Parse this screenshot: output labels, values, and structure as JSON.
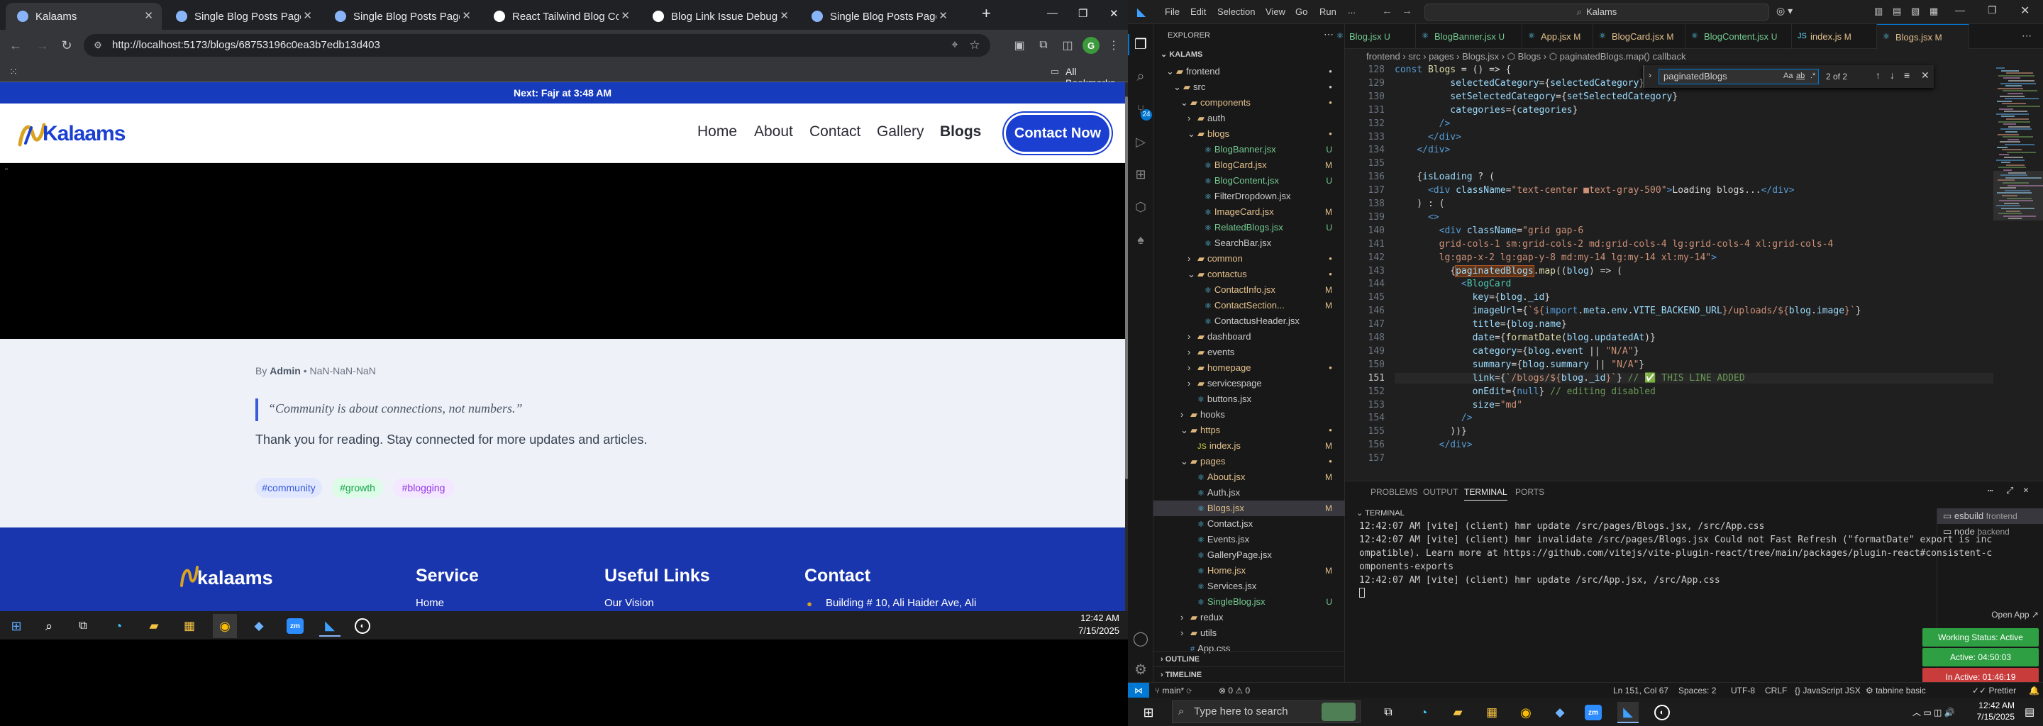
{
  "chrome": {
    "tabs": [
      {
        "title": "Kalaams"
      },
      {
        "title": "Single Blog Posts Page Design"
      },
      {
        "title": "Single Blog Posts Page Design"
      },
      {
        "title": "React Tailwind Blog Conversion"
      },
      {
        "title": "Blog Link Issue Debugging"
      },
      {
        "title": "Single Blog Posts Page Design"
      }
    ],
    "new_tab": "+",
    "url": "http://localhost:5173/blogs/68753196c0ea3b7edb13d403",
    "all_bookmarks": "All Bookmarks",
    "profile_initial": "G"
  },
  "site": {
    "announcement": "Next: Fajr at 3:48 AM",
    "logo": "Kalaams",
    "nav": [
      "Home",
      "About",
      "Contact",
      "Gallery",
      "Blogs"
    ],
    "cta": "Contact Now",
    "meta_by": "By",
    "meta_author": "Admin",
    "meta_date": "• NaN-NaN-NaN",
    "quote": "“Community is about connections, not numbers.”",
    "thanks": "Thank you for reading. Stay connected for more updates and articles.",
    "tags": [
      "#community",
      "#growth",
      "#blogging"
    ],
    "footer": {
      "logo": "kalaams",
      "cols": [
        {
          "title": "Service",
          "item": "Home"
        },
        {
          "title": "Useful Links",
          "item": "Our Vision"
        },
        {
          "title": "Contact",
          "item": "Building # 10, Ali Haider Ave, Ali"
        }
      ]
    }
  },
  "taskbar_left": {
    "time": "12:42 AM",
    "date": "7/15/2025"
  },
  "vscode": {
    "menu": [
      "File",
      "Edit",
      "Selection",
      "View",
      "Go",
      "Run",
      "..."
    ],
    "search": "Kalams",
    "tabs": [
      {
        "name": "Blog.jsx",
        "flag": "U"
      },
      {
        "name": "BlogBanner.jsx",
        "flag": "U"
      },
      {
        "name": "App.jsx",
        "flag": "M"
      },
      {
        "name": "BlogCard.jsx",
        "flag": "M"
      },
      {
        "name": "BlogContent.jsx",
        "flag": "U"
      },
      {
        "name": "index.js",
        "flag": "M"
      },
      {
        "name": "Blogs.jsx",
        "flag": "M"
      }
    ],
    "breadcrumb": "frontend › src › pages › Blogs.jsx › ⬡ Blogs › ⬡ paginatedBlogs.map() callback",
    "find": {
      "query": "paginatedBlogs",
      "count": "2 of 2",
      "aa": "Aa",
      "ab": "ab",
      "re": ".*"
    },
    "explorer": {
      "header": "EXPLORER",
      "root": "KALAMS",
      "items": [
        {
          "label": "frontend",
          "depth": 0,
          "folder": true,
          "open": true,
          "dot": true
        },
        {
          "label": "src",
          "depth": 1,
          "folder": true,
          "open": true,
          "dot": true
        },
        {
          "label": "components",
          "depth": 2,
          "folder": true,
          "open": true,
          "dot": true,
          "color": "#e2c08d"
        },
        {
          "label": "auth",
          "depth": 3,
          "folder": true,
          "open": false,
          "dot": false
        },
        {
          "label": "blogs",
          "depth": 3,
          "folder": true,
          "open": true,
          "dot": true,
          "color": "#e2c08d"
        },
        {
          "label": "BlogBanner.jsx",
          "depth": 4,
          "badge": "U",
          "color": "#73c991"
        },
        {
          "label": "BlogCard.jsx",
          "depth": 4,
          "badge": "M",
          "color": "#e2c08d"
        },
        {
          "label": "BlogContent.jsx",
          "depth": 4,
          "badge": "U",
          "color": "#73c991"
        },
        {
          "label": "FilterDropdown.jsx",
          "depth": 4
        },
        {
          "label": "ImageCard.jsx",
          "depth": 4,
          "badge": "M",
          "color": "#e2c08d"
        },
        {
          "label": "RelatedBlogs.jsx",
          "depth": 4,
          "badge": "U",
          "color": "#73c991"
        },
        {
          "label": "SearchBar.jsx",
          "depth": 4
        },
        {
          "label": "common",
          "depth": 3,
          "folder": true,
          "open": false,
          "dot": true,
          "color": "#e2c08d"
        },
        {
          "label": "contactus",
          "depth": 3,
          "folder": true,
          "open": true,
          "dot": true,
          "color": "#e2c08d"
        },
        {
          "label": "ContactInfo.jsx",
          "depth": 4,
          "badge": "M",
          "color": "#e2c08d"
        },
        {
          "label": "ContactSection...",
          "depth": 4,
          "badge": "M",
          "color": "#e2c08d"
        },
        {
          "label": "ContactusHeader.jsx",
          "depth": 4
        },
        {
          "label": "dashboard",
          "depth": 3,
          "folder": true,
          "open": false
        },
        {
          "label": "events",
          "depth": 3,
          "folder": true,
          "open": false
        },
        {
          "label": "homepage",
          "depth": 3,
          "folder": true,
          "open": false,
          "dot": true,
          "color": "#e2c08d"
        },
        {
          "label": "servicespage",
          "depth": 3,
          "folder": true,
          "open": false
        },
        {
          "label": "buttons.jsx",
          "depth": 3
        },
        {
          "label": "hooks",
          "depth": 2,
          "folder": true,
          "open": false
        },
        {
          "label": "https",
          "depth": 2,
          "folder": true,
          "open": true,
          "dot": true,
          "color": "#e2c08d"
        },
        {
          "label": "index.js",
          "depth": 3,
          "badge": "M",
          "color": "#e2c08d"
        },
        {
          "label": "pages",
          "depth": 2,
          "folder": true,
          "open": true,
          "dot": true,
          "color": "#e2c08d"
        },
        {
          "label": "About.jsx",
          "depth": 3,
          "badge": "M",
          "color": "#e2c08d"
        },
        {
          "label": "Auth.jsx",
          "depth": 3
        },
        {
          "label": "Blogs.jsx",
          "depth": 3,
          "badge": "M",
          "color": "#e2c08d",
          "selected": true
        },
        {
          "label": "Contact.jsx",
          "depth": 3
        },
        {
          "label": "Events.jsx",
          "depth": 3
        },
        {
          "label": "GalleryPage.jsx",
          "depth": 3
        },
        {
          "label": "Home.jsx",
          "depth": 3,
          "badge": "M",
          "color": "#e2c08d"
        },
        {
          "label": "Services.jsx",
          "depth": 3
        },
        {
          "label": "SingleBlog.jsx",
          "depth": 3,
          "badge": "U",
          "color": "#73c991"
        },
        {
          "label": "redux",
          "depth": 2,
          "folder": true,
          "open": false
        },
        {
          "label": "utils",
          "depth": 2,
          "folder": true,
          "open": false
        },
        {
          "label": "App.css",
          "depth": 2
        }
      ],
      "outline": "OUTLINE",
      "timeline": "TIMELINE"
    },
    "code": [
      {
        "n": "128",
        "h": "<span class='cl-w'>const</span> <span class='f'>Blogs</span> = () => {"
      },
      {
        "n": "129",
        "h": "          <span class='a'>selectedCategory</span>={<span class='a'>selectedCategory</span>}"
      },
      {
        "n": "130",
        "h": "          <span class='a'>setSelectedCategory</span>={<span class='a'>setSelectedCategory</span>}"
      },
      {
        "n": "131",
        "h": "          <span class='a'>categories</span>={<span class='a'>categories</span>}"
      },
      {
        "n": "132",
        "h": "        <span class='b'>/&gt;</span>"
      },
      {
        "n": "133",
        "h": "      <span class='b'>&lt;/div&gt;</span>"
      },
      {
        "n": "134",
        "h": "    <span class='b'>&lt;/div&gt;</span>"
      },
      {
        "n": "135",
        "h": ""
      },
      {
        "n": "136",
        "h": "    {<span class='a'>isLoading</span> ? ("
      },
      {
        "n": "137",
        "h": "      <span class='b'>&lt;div</span> <span class='a'>className</span>=<span class='s'>\"text-center ■text-gray-500\"</span><span class='b'>&gt;</span>Loading blogs...<span class='b'>&lt;/div&gt;</span>"
      },
      {
        "n": "138",
        "h": "    ) : ("
      },
      {
        "n": "139",
        "h": "      <span class='b'>&lt;&gt;</span>"
      },
      {
        "n": "140",
        "h": "        <span class='b'>&lt;div</span> <span class='a'>className</span>=<span class='s'>\"grid gap-6</span>"
      },
      {
        "n": "141",
        "h": "        <span class='s'>grid-cols-1 sm:grid-cols-2 md:grid-cols-4 lg:grid-cols-4 xl:grid-cols-4</span>"
      },
      {
        "n": "142",
        "h": "        <span class='s'>lg:gap-x-2 lg:gap-y-8 md:my-14 lg:my-14 xl:my-14\"</span><span class='b'>&gt;</span>"
      },
      {
        "n": "143",
        "h": "          {<span class='a hl'>paginatedBlogs</span>.<span class='f'>map</span>((<span class='a'>blog</span>) => ("
      },
      {
        "n": "144",
        "h": "            <span class='b'>&lt;</span><span class='tg'>BlogCard</span>"
      },
      {
        "n": "145",
        "h": "              <span class='a'>key</span>={<span class='a'>blog</span>.<span class='a'>_id</span>}"
      },
      {
        "n": "146",
        "h": "              <span class='a'>imageUrl</span>={<span class='s'>`${</span><span class='b'>import</span>.<span class='a'>meta</span>.<span class='a'>env</span>.<span class='a'>VITE_BACKEND_URL</span><span class='s'>}/uploads/${</span><span class='a'>blog</span>.<span class='a'>image</span><span class='s'>}`</span>}"
      },
      {
        "n": "147",
        "h": "              <span class='a'>title</span>={<span class='a'>blog</span>.<span class='a'>name</span>}"
      },
      {
        "n": "148",
        "h": "              <span class='a'>date</span>={<span class='f'>formatDate</span>(<span class='a'>blog</span>.<span class='a'>updatedAt</span>)}"
      },
      {
        "n": "149",
        "h": "              <span class='a'>category</span>={<span class='a'>blog</span>.<span class='a'>event</span> || <span class='s'>\"N/A\"</span>}"
      },
      {
        "n": "150",
        "h": "              <span class='a'>summary</span>={<span class='a'>blog</span>.<span class='a'>summary</span> || <span class='s'>\"N/A\"</span>}"
      },
      {
        "n": "151",
        "h": "              <span class='a'>link</span>={<span class='s'>`/blogs/${</span><span class='a'>blog</span>.<span class='a'>_id</span><span class='s'>}`</span>} <span class='c'>// ✅ THIS LINE ADDED</span>"
      },
      {
        "n": "152",
        "h": "              <span class='a'>onEdit</span>={<span class='b'>null</span>} <span class='c'>// editing disabled</span>"
      },
      {
        "n": "153",
        "h": "              <span class='a'>size</span>=<span class='s'>\"md\"</span>"
      },
      {
        "n": "154",
        "h": "            <span class='b'>/&gt;</span>"
      },
      {
        "n": "155",
        "h": "          ))}"
      },
      {
        "n": "156",
        "h": "        <span class='b'>&lt;/div&gt;</span>"
      },
      {
        "n": "157",
        "h": ""
      }
    ],
    "panel": {
      "tabs": [
        "PROBLEMS",
        "OUTPUT",
        "TERMINAL",
        "PORTS"
      ],
      "terminal_label": "TERMINAL",
      "lines": [
        "12:42:07 AM [vite] (client) hmr update /src/pages/Blogs.jsx, /src/App.css",
        "12:42:07 AM [vite] (client) hmr invalidate /src/pages/Blogs.jsx Could not Fast Refresh (\"formatDate\" export is inc",
        "ompatible). Learn more at https://github.com/vitejs/vite-plugin-react/tree/main/packages/plugin-react#consistent-c",
        "omponents-exports",
        "12:42:07 AM [vite] (client) hmr update /src/App.jsx, /src/App.css"
      ],
      "terminals": [
        {
          "name": "esbuild",
          "cwd": "frontend"
        },
        {
          "name": "node",
          "cwd": "backend"
        }
      ],
      "open_app": "Open App ↗",
      "working_status": "Working Status: Active",
      "active": "Active: 04:50:03",
      "inactive": "In Active: 01:46:19"
    },
    "status": {
      "branch": "main*",
      "errors": "⊗ 0 ⚠ 0",
      "pos": "Ln 151, Col 67",
      "spaces": "Spaces: 2",
      "enc": "UTF-8",
      "eol": "CRLF",
      "lang": "JavaScript JSX",
      "ext": "tabnine basic",
      "prettier": "Prettier"
    },
    "taskbar": {
      "search": "Type here to search",
      "time": "12:42 AM",
      "date": "7/15/2025"
    }
  },
  "colors": {
    "brand_blue": "#1a3fd1",
    "vscode_bg": "#1f1f1f",
    "accent": "#0078d4"
  }
}
